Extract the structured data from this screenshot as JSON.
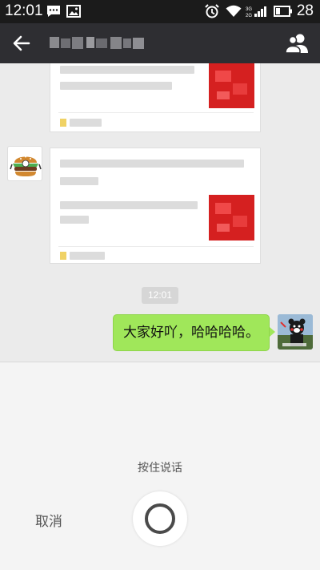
{
  "status_bar": {
    "time": "12:01",
    "battery": "28",
    "icons": [
      "message-icon",
      "image-icon",
      "alarm-icon",
      "wifi-icon",
      "signal-icon",
      "battery-icon"
    ]
  },
  "nav": {
    "back_icon": "arrow-left-icon",
    "contacts_icon": "group-icon"
  },
  "chat": {
    "timestamp": "12:01",
    "messages": [
      {
        "from": "other",
        "type": "link-card"
      },
      {
        "from": "other",
        "type": "link-card"
      },
      {
        "from": "self",
        "type": "text",
        "text": "大家好吖，哈哈哈哈。"
      }
    ]
  },
  "voice_panel": {
    "hint": "按住说话",
    "cancel_label": "取消",
    "record_icon": "record-circle-icon"
  },
  "colors": {
    "status_bar_bg": "#1b1b1b",
    "nav_bg": "#2e2e32",
    "chat_bg": "#ebebeb",
    "bubble_self": "#a0e75a",
    "panel_bg": "#f4f4f4"
  }
}
